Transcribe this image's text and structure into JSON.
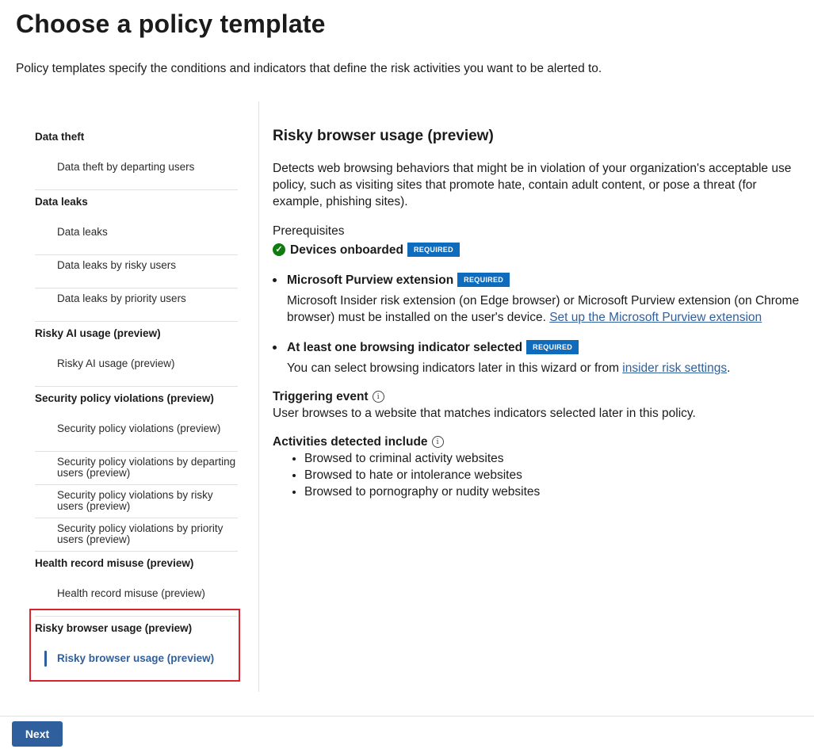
{
  "page": {
    "title": "Choose a policy template",
    "subtitle": "Policy templates specify the conditions and indicators that define the risk activities you want to be alerted to."
  },
  "nav": {
    "groups": [
      {
        "heading": "Data theft",
        "items": [
          "Data theft by departing users"
        ]
      },
      {
        "heading": "Data leaks",
        "items": [
          "Data leaks",
          "Data leaks by risky users",
          "Data leaks by priority users"
        ]
      },
      {
        "heading": "Risky AI usage (preview)",
        "items": [
          "Risky AI usage (preview)"
        ]
      },
      {
        "heading": "Security policy violations (preview)",
        "items": [
          "Security policy violations (preview)",
          "Security policy violations by departing users (preview)",
          "Security policy violations by risky users (preview)",
          "Security policy violations by priority users (preview)"
        ]
      },
      {
        "heading": "Health record misuse (preview)",
        "items": [
          "Health record misuse (preview)"
        ]
      },
      {
        "heading": "Risky browser usage (preview)",
        "items": [
          "Risky browser usage (preview)"
        ]
      }
    ],
    "selected_item": "Risky browser usage (preview)"
  },
  "detail": {
    "title": "Risky browser usage (preview)",
    "description": "Detects web browsing behaviors that might be in violation of your organization's acceptable use policy, such as visiting sites that promote hate, contain adult content, or pose a threat (for example, phishing sites).",
    "prereq_label": "Prerequisites",
    "devices_onboarded": "Devices onboarded",
    "required_badge": "REQUIRED",
    "extension": {
      "title": "Microsoft Purview extension",
      "body": "Microsoft Insider risk extension (on Edge browser) or Microsoft Purview extension (on Chrome browser) must be installed on the user's device. ",
      "link": "Set up the Microsoft Purview extension"
    },
    "indicator": {
      "title": "At least one browsing indicator selected",
      "body": "You can select browsing indicators later in this wizard or from ",
      "link": "insider risk settings",
      "suffix": "."
    },
    "triggering": {
      "label": "Triggering event",
      "body": "User browses to a website that matches indicators selected later in this policy."
    },
    "activities": {
      "label": "Activities detected include",
      "items": [
        "Browsed to criminal activity websites",
        "Browsed to hate or intolerance websites",
        "Browsed to pornography or nudity websites"
      ]
    },
    "info_glyph": "i"
  },
  "footer": {
    "next_label": "Next"
  },
  "colors": {
    "accent": "#2f5f9c",
    "badge": "#0f6cbd",
    "success": "#107c10",
    "highlight": "#d9232e"
  }
}
